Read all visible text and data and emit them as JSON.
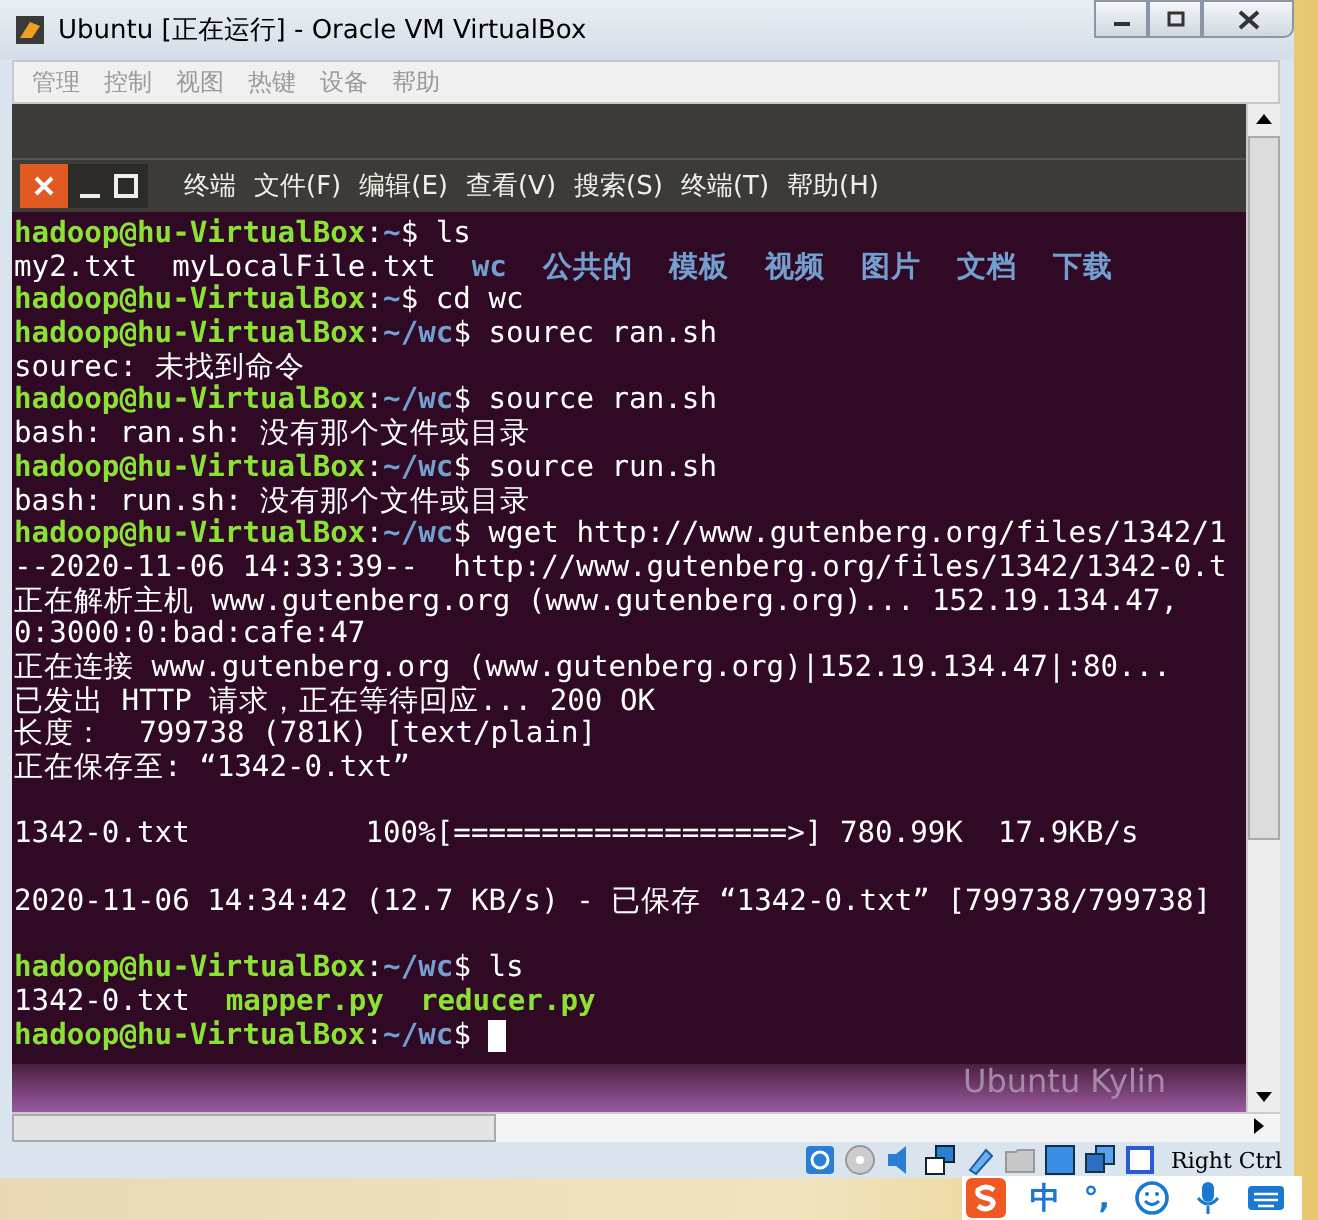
{
  "window": {
    "title": "Ubuntu [正在运行] - Oracle VM VirtualBox"
  },
  "menu": [
    {
      "label": "管理",
      "disabled": true
    },
    {
      "label": "控制",
      "disabled": true
    },
    {
      "label": "视图",
      "disabled": true
    },
    {
      "label": "热键",
      "disabled": true
    },
    {
      "label": "设备",
      "disabled": true
    },
    {
      "label": "帮助",
      "disabled": true
    }
  ],
  "terminal": {
    "menu": [
      "终端",
      "文件(F)",
      "编辑(E)",
      "查看(V)",
      "搜索(S)",
      "终端(T)",
      "帮助(H)"
    ],
    "blocks": [
      {
        "lines": [
          {
            "segments": [
              {
                "kind": "user",
                "text": "hadoop@hu-VirtualBox"
              },
              {
                "kind": "plain",
                "text": ":"
              },
              {
                "kind": "path",
                "text": "~"
              },
              {
                "kind": "plain",
                "text": "$ ls"
              }
            ]
          },
          {
            "segments": [
              {
                "kind": "plain",
                "text": "my2.txt  myLocalFile.txt"
              },
              {
                "kind": "dir",
                "text": "wc"
              },
              {
                "kind": "dir",
                "text": "公共的"
              },
              {
                "kind": "dir",
                "text": "模板"
              },
              {
                "kind": "dir",
                "text": "视频"
              },
              {
                "kind": "dir",
                "text": "图片"
              },
              {
                "kind": "dir",
                "text": "文档"
              },
              {
                "kind": "dir",
                "text": "下载"
              }
            ]
          },
          {
            "segments": [
              {
                "kind": "user",
                "text": "hadoop@hu-VirtualBox"
              },
              {
                "kind": "plain",
                "text": ":"
              },
              {
                "kind": "path",
                "text": "~"
              },
              {
                "kind": "plain",
                "text": "$ cd wc"
              }
            ]
          },
          {
            "segments": [
              {
                "kind": "user",
                "text": "hadoop@hu-VirtualBox"
              },
              {
                "kind": "plain",
                "text": ":"
              },
              {
                "kind": "path",
                "text": "~/wc"
              },
              {
                "kind": "plain",
                "text": "$ sourec ran.sh"
              }
            ]
          },
          {
            "segments": [
              {
                "kind": "plain",
                "text": "sourec: 未找到命令"
              }
            ]
          },
          {
            "segments": [
              {
                "kind": "user",
                "text": "hadoop@hu-VirtualBox"
              },
              {
                "kind": "plain",
                "text": ":"
              },
              {
                "kind": "path",
                "text": "~/wc"
              },
              {
                "kind": "plain",
                "text": "$ source ran.sh"
              }
            ]
          },
          {
            "segments": [
              {
                "kind": "plain",
                "text": "bash: ran.sh: 没有那个文件或目录"
              }
            ]
          },
          {
            "segments": [
              {
                "kind": "user",
                "text": "hadoop@hu-VirtualBox"
              },
              {
                "kind": "plain",
                "text": ":"
              },
              {
                "kind": "path",
                "text": "~/wc"
              },
              {
                "kind": "plain",
                "text": "$ source run.sh"
              }
            ]
          },
          {
            "segments": [
              {
                "kind": "plain",
                "text": "bash: run.sh: 没有那个文件或目录"
              }
            ]
          },
          {
            "segments": [
              {
                "kind": "user",
                "text": "hadoop@hu-VirtualBox"
              },
              {
                "kind": "plain",
                "text": ":"
              },
              {
                "kind": "path",
                "text": "~/wc"
              },
              {
                "kind": "plain",
                "text": "$ wget http://www.gutenberg.org/files/1342/1"
              }
            ]
          },
          {
            "segments": [
              {
                "kind": "plain",
                "text": "--2020-11-06 14:33:39--  http://www.gutenberg.org/files/1342/1342-0.t"
              }
            ]
          },
          {
            "segments": [
              {
                "kind": "plain",
                "text": "正在解析主机 www.gutenberg.org (www.gutenberg.org)... 152.19.134.47,"
              }
            ]
          },
          {
            "segments": [
              {
                "kind": "plain",
                "text": "0:3000:0:bad:cafe:47"
              }
            ]
          },
          {
            "segments": [
              {
                "kind": "plain",
                "text": "正在连接 www.gutenberg.org (www.gutenberg.org)|152.19.134.47|:80..."
              }
            ]
          },
          {
            "segments": [
              {
                "kind": "plain",
                "text": "已发出 HTTP 请求，正在等待回应... 200 OK"
              }
            ]
          },
          {
            "segments": [
              {
                "kind": "plain",
                "text": "长度：  799738 (781K) [text/plain]"
              }
            ]
          },
          {
            "segments": [
              {
                "kind": "plain",
                "text": "正在保存至: “1342-0.txt”"
              }
            ]
          }
        ]
      },
      {
        "lines": [
          {
            "segments": [
              {
                "kind": "plain",
                "text": "1342-0.txt          100%[===================>] 780.99K  17.9KB/s"
              }
            ]
          }
        ]
      },
      {
        "lines": [
          {
            "segments": [
              {
                "kind": "plain",
                "text": "2020-11-06 14:34:42 (12.7 KB/s) - 已保存 “1342-0.txt” [799738/799738]"
              }
            ]
          }
        ]
      },
      {
        "lines": [
          {
            "segments": [
              {
                "kind": "user",
                "text": "hadoop@hu-VirtualBox"
              },
              {
                "kind": "plain",
                "text": ":"
              },
              {
                "kind": "path",
                "text": "~/wc"
              },
              {
                "kind": "plain",
                "text": "$ ls"
              }
            ]
          },
          {
            "segments": [
              {
                "kind": "plain",
                "text": "1342-0.txt"
              },
              {
                "kind": "exec",
                "text": "mapper.py"
              },
              {
                "kind": "exec",
                "text": "reducer.py"
              }
            ]
          },
          {
            "segments": [
              {
                "kind": "user",
                "text": "hadoop@hu-VirtualBox"
              },
              {
                "kind": "plain",
                "text": ":"
              },
              {
                "kind": "path",
                "text": "~/wc"
              },
              {
                "kind": "plain",
                "text": "$"
              }
            ],
            "cursor": true
          }
        ]
      }
    ]
  },
  "desktop": {
    "caption": "Ubuntu Kylin"
  },
  "status_bar": {
    "hint": "Right Ctrl"
  },
  "ime": {
    "mode": "中",
    "punct": "°,"
  }
}
